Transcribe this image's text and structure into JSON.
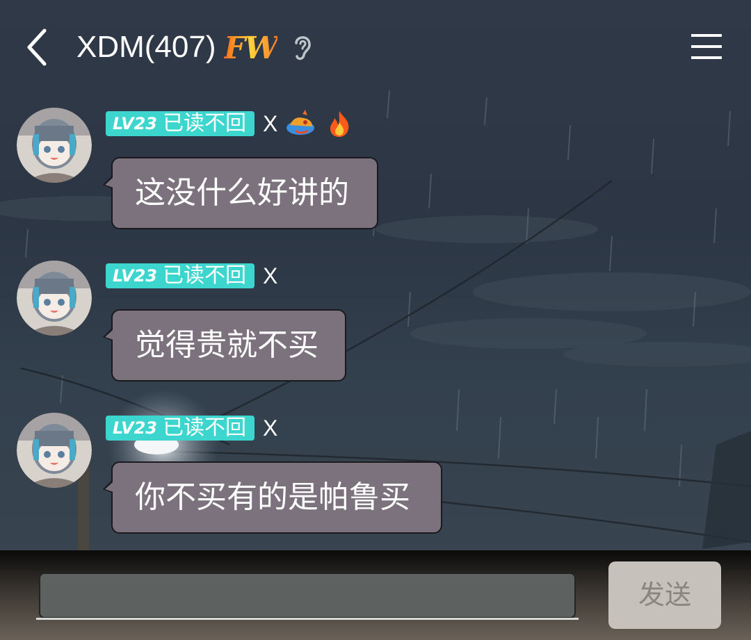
{
  "header": {
    "title": "XDM(407)",
    "badge": "FW",
    "back_icon": "back-chevron-icon",
    "ear_icon": "ear-icon",
    "menu_icon": "hamburger-menu-icon"
  },
  "messages": [
    {
      "level": "LV23",
      "sender": "已读不回",
      "suffix": "X",
      "emojis": [
        "dragon-emoji",
        "fire-emoji"
      ],
      "text": "这没什么好讲的"
    },
    {
      "level": "LV23",
      "sender": "已读不回",
      "suffix": "X",
      "emojis": [],
      "text": "觉得贵就不买"
    },
    {
      "level": "LV23",
      "sender": "已读不回",
      "suffix": "X",
      "emojis": [],
      "text": "你不买有的是帕鲁买"
    }
  ],
  "composer": {
    "value": "",
    "send_label": "发送"
  },
  "colors": {
    "level_badge": "#3dd6cf",
    "bubble": "#7c727e",
    "send_button": "#c6c1ba"
  }
}
